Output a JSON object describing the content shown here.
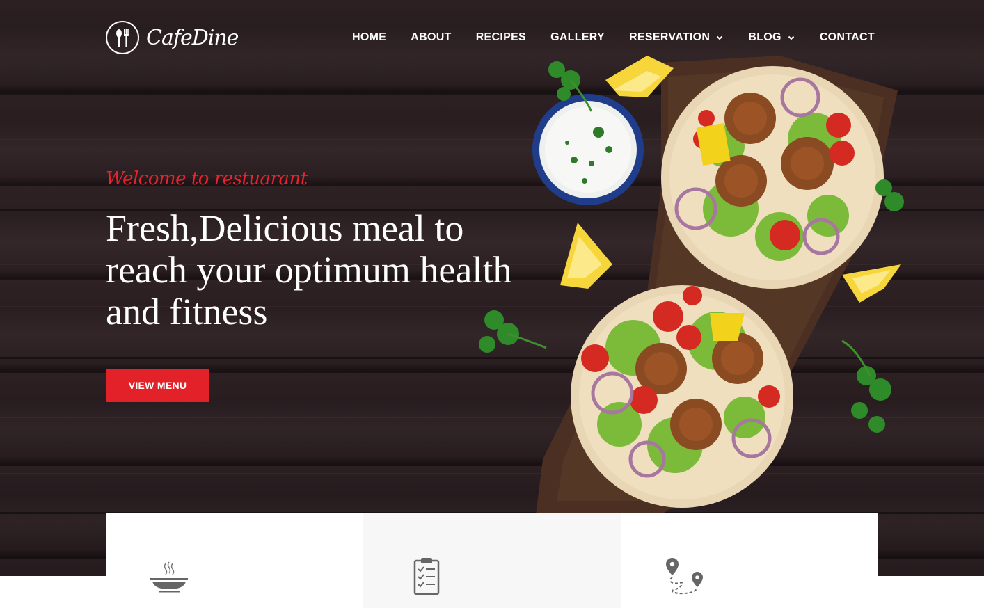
{
  "brand": {
    "name": "CafeDine",
    "logo_icon": "fork-spoon-icon"
  },
  "nav": {
    "items": [
      {
        "label": "HOME",
        "has_dropdown": false
      },
      {
        "label": "ABOUT",
        "has_dropdown": false
      },
      {
        "label": "RECIPES",
        "has_dropdown": false
      },
      {
        "label": "GALLERY",
        "has_dropdown": false
      },
      {
        "label": "RESERVATION",
        "has_dropdown": true
      },
      {
        "label": "BLOG",
        "has_dropdown": true
      },
      {
        "label": "CONTACT",
        "has_dropdown": false
      }
    ]
  },
  "hero": {
    "welcome": "Welcome to restuarant",
    "headline_line1": "Fresh,Delicious meal to",
    "headline_line2": "reach your optimum health",
    "headline_line3": "and fitness",
    "cta_label": "VIEW MENU"
  },
  "features": [
    {
      "icon": "soup-bowl-icon"
    },
    {
      "icon": "checklist-icon"
    },
    {
      "icon": "route-pins-icon"
    }
  ],
  "colors": {
    "accent": "#e32129",
    "welcome": "#e8232f",
    "hero_bg": "#2c2023",
    "card_grey": "#f7f7f7",
    "icon_grey": "#666666"
  }
}
